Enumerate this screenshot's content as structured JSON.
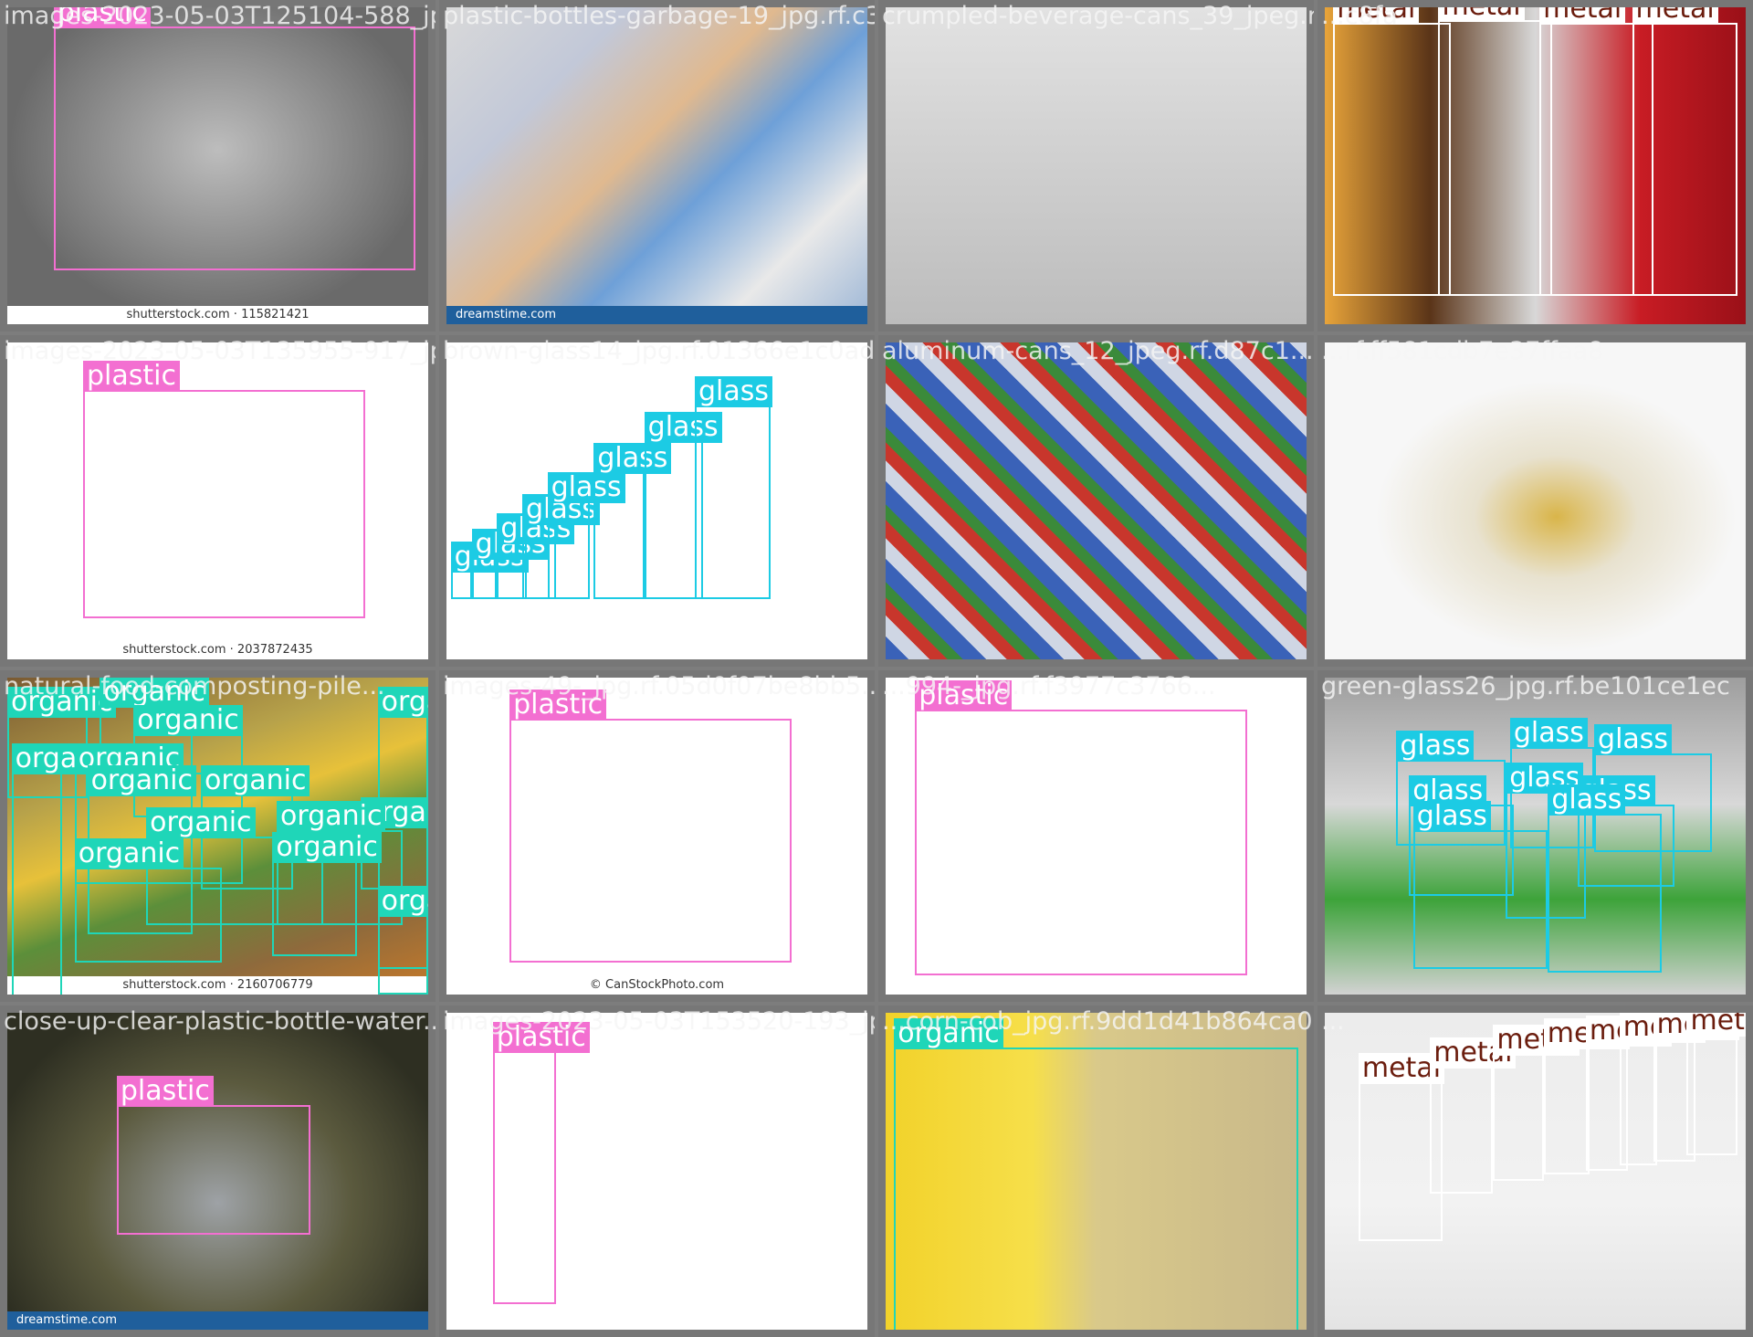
{
  "colors": {
    "plastic": "#f36fd1",
    "glass": "#1ccbe4",
    "metal": "#6b1d0e",
    "organic": "#1fd6b8",
    "metal_box": "#ffffff"
  },
  "tiles": [
    {
      "filename": "images-2023-05-03T125104-588_jpg.rf.c3b1c1...",
      "bg": "bg-gray",
      "credit": "shutterstock.com · 115821421",
      "credit_style": "white",
      "boxes": [
        {
          "label": "plastic"
        }
      ]
    },
    {
      "filename": "plastic-bottles-garbage-19_jpg.rf.c3b1c1e...",
      "bg": "bg-trash",
      "credit": "dreamstime.com",
      "credit_style": "blue",
      "boxes": []
    },
    {
      "filename": "crumpled-beverage-cans_39_jpeg.rf.1bd9f4...",
      "bg": "bg-can",
      "credit": "",
      "credit_style": "none",
      "boxes": []
    },
    {
      "filename": "...c8fa",
      "bg": "bg-nescafe",
      "credit": "",
      "credit_style": "none",
      "boxes": [
        {
          "label": "metal"
        },
        {
          "label": "metal"
        },
        {
          "label": "metal"
        },
        {
          "label": "metal"
        }
      ]
    },
    {
      "filename": "images-2023-05-03T135955-917_jpg.rf.01366e1c0a...",
      "bg": "bg-white",
      "credit": "shutterstock.com · 2037872435",
      "credit_style": "white",
      "boxes": [
        {
          "label": "plastic"
        }
      ]
    },
    {
      "filename": "brown-glass14_jpg.rf.01366e1c0ade3a5ff6...",
      "bg": "bg-white",
      "credit": "",
      "credit_style": "none",
      "boxes": [
        {
          "label": "glass"
        },
        {
          "label": "glass"
        },
        {
          "label": "glass"
        },
        {
          "label": "glass"
        },
        {
          "label": "glass"
        },
        {
          "label": "glass"
        },
        {
          "label": "glass"
        },
        {
          "label": "glass"
        }
      ]
    },
    {
      "filename": "aluminum-cans_12_jpeg.rf.d87c1...",
      "bg": "bg-cans",
      "credit": "",
      "credit_style": "none",
      "boxes": []
    },
    {
      "filename": "...rf.ff581cdb7e37ffaa8",
      "bg": "bg-tissue",
      "credit": "",
      "credit_style": "none",
      "boxes": []
    },
    {
      "filename": "natural-food-composting-pile...",
      "bg": "bg-compost",
      "credit": "shutterstock.com · 2160706779",
      "credit_style": "white",
      "boxes": [
        {
          "label": "organic"
        },
        {
          "label": "organic"
        },
        {
          "label": "organic"
        },
        {
          "label": "organic"
        },
        {
          "label": "organic"
        },
        {
          "label": "organic"
        },
        {
          "label": "organic"
        },
        {
          "label": "organic"
        },
        {
          "label": "organic"
        },
        {
          "label": "organic"
        },
        {
          "label": "organic"
        },
        {
          "label": "organic"
        },
        {
          "label": "organic"
        },
        {
          "label": "organic"
        }
      ]
    },
    {
      "filename": "images-49-_jpg.rf.05d0f07be8bb5...",
      "bg": "bg-white",
      "credit": "© CanStockPhoto.com",
      "credit_style": "white",
      "boxes": [
        {
          "label": "plastic"
        }
      ]
    },
    {
      "filename": "...994-_jpg.rf.f3977c3766...",
      "bg": "bg-white",
      "credit": "",
      "credit_style": "none",
      "boxes": [
        {
          "label": "plastic"
        }
      ]
    },
    {
      "filename": "green-glass26_jpg.rf.be101ce1ec",
      "bg": "bg-green-glass",
      "credit": "",
      "credit_style": "none",
      "boxes": [
        {
          "label": "glass"
        },
        {
          "label": "glass"
        },
        {
          "label": "glass"
        },
        {
          "label": "glass"
        },
        {
          "label": "glass"
        },
        {
          "label": "glass"
        },
        {
          "label": "glass"
        },
        {
          "label": "glass"
        }
      ]
    },
    {
      "filename": "close-up-clear-plastic-bottle-water...",
      "bg": "bg-outdoor",
      "credit": "dreamstime.com",
      "credit_style": "blue",
      "boxes": [
        {
          "label": "plastic"
        }
      ]
    },
    {
      "filename": "images-2023-05-03T153520-193_jpg.rf.1b46...",
      "bg": "bg-white",
      "credit": "",
      "credit_style": "none",
      "boxes": [
        {
          "label": "plastic"
        }
      ]
    },
    {
      "filename": "...corn-cob_jpg.rf.9dd1d41b864ca0...",
      "bg": "bg-corn",
      "credit": "",
      "credit_style": "none",
      "boxes": [
        {
          "label": "organic"
        }
      ]
    },
    {
      "filename": "...",
      "bg": "bg-cans2",
      "credit": "",
      "credit_style": "none",
      "boxes": [
        {
          "label": "metal"
        },
        {
          "label": "metal"
        },
        {
          "label": "metal"
        },
        {
          "label": "metal"
        },
        {
          "label": "metal"
        },
        {
          "label": "metal"
        },
        {
          "label": "metal"
        },
        {
          "label": "metal"
        }
      ]
    }
  ]
}
